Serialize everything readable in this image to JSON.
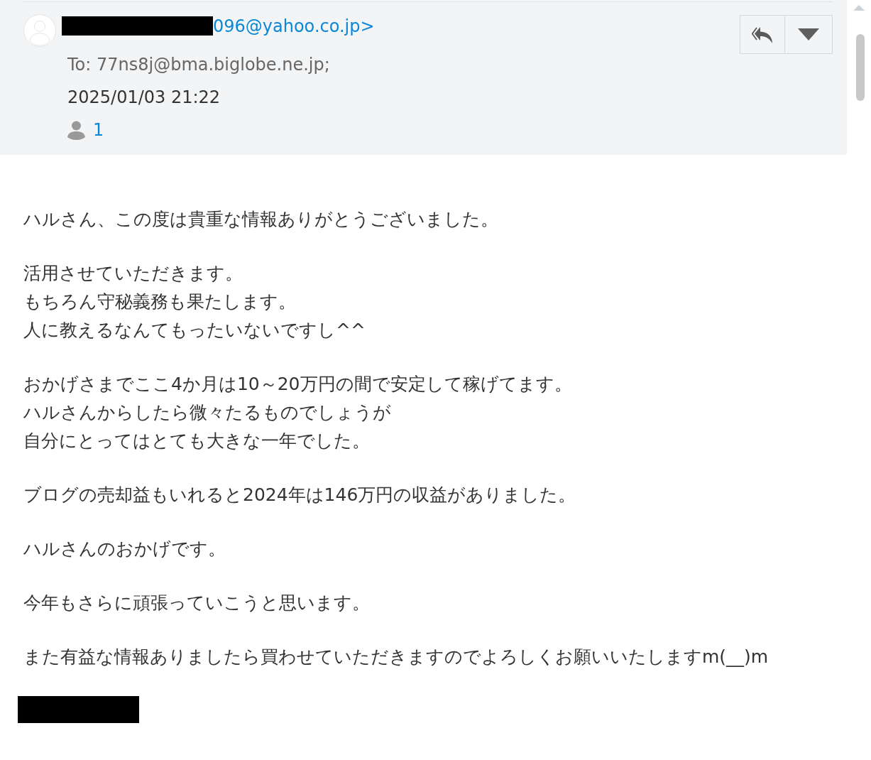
{
  "header": {
    "sender_address": "096@yahoo.co.jp>",
    "to": "To: 77ns8j@bma.biglobe.ne.jp;",
    "date": "2025/01/03 21:22",
    "recipient_count": "1"
  },
  "body": {
    "paragraphs": [
      [
        "ハルさん、この度は貴重な情報ありがとうございました。"
      ],
      [
        "活用させていただきます。",
        "もちろん守秘義務も果たします。",
        "人に教えるなんてもったいないですし^^"
      ],
      [
        "おかげさまでここ4か月は10～20万円の間で安定して稼げてます。",
        "ハルさんからしたら微々たるものでしょうが",
        "自分にとってはとても大きな一年でした。"
      ],
      [
        "ブログの売却益もいれると2024年は146万円の収益がありました。"
      ],
      [
        "ハルさんのおかげです。"
      ],
      [
        "今年もさらに頑張っていこうと思います。"
      ],
      [
        "また有益な情報ありましたら買わせていただきますのでよろしくお願いいたしますm(__)m"
      ]
    ]
  }
}
